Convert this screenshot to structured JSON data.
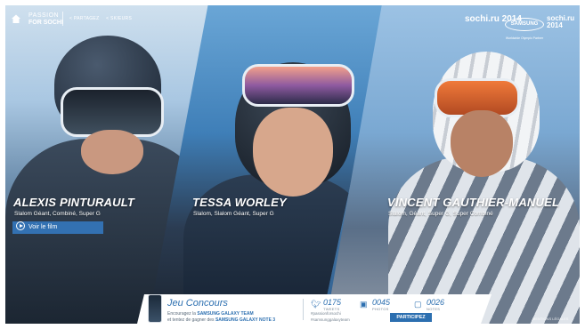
{
  "header": {
    "brand_line1": "PASSION",
    "brand_line2": "FOR SOCHI",
    "breadcrumbs": [
      "< PARTAGEZ",
      "< SKIEURS"
    ],
    "sochi_logo": "sochi.ru 2014",
    "samsung_logo": "SAMSUNG",
    "samsung_sub": "Worldwide Olympic Partner",
    "paralympic_logo": "sochi.ru 2014"
  },
  "athletes": [
    {
      "name": "ALEXIS PINTURAULT",
      "events": "Slalom Géant, Combiné, Super G"
    },
    {
      "name": "TESSA WORLEY",
      "events": "Slalom, Slalom Géant, Super G"
    },
    {
      "name": "VINCENT GAUTHIER-MANUEL",
      "events": "Slalom, Géant, Super G, Super Combiné"
    }
  ],
  "watch_film_label": "Voir le film",
  "contest": {
    "title": "Jeu Concours",
    "line1_prefix": "Encouragez la ",
    "line1_bold": "SAMSUNG GALAXY TEAM",
    "line2_prefix": "et tentez de gagner des ",
    "line2_bold": "SAMSUNG GALAXY NOTE 3",
    "stats": [
      {
        "icon": "twitter-icon",
        "value": "0175",
        "label": "TWEETS"
      },
      {
        "icon": "camera-icon",
        "value": "0045",
        "label": "PHOTOS"
      },
      {
        "icon": "note-icon",
        "value": "0026",
        "label": "NOTES"
      }
    ],
    "hashtag1": "#passionforsochi",
    "hashtag2": "#samsunggalaxyteam",
    "participate_label": "PARTICIPEZ"
  },
  "footer_note": "MENTIONS LÉGALES",
  "colors": {
    "accent": "#2c6fb0",
    "panel_blue": "#3478be"
  }
}
